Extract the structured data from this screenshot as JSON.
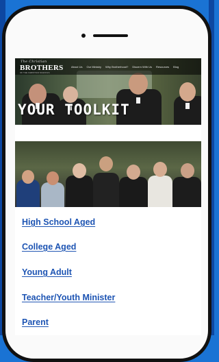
{
  "site": {
    "logo_script": "The Christian",
    "logo_main": "BROTHERS",
    "logo_sub": "OF THE CHRISTIAN SCHOOLS"
  },
  "nav": {
    "items": [
      "About Us",
      "Our Ministry",
      "Why Brotherhood?",
      "Discern With Us",
      "Resources",
      "Blog"
    ]
  },
  "hero": {
    "title": "YOUR TOOLKIT"
  },
  "links": [
    {
      "label": "High School Aged"
    },
    {
      "label": "College Aged"
    },
    {
      "label": "Young Adult"
    },
    {
      "label": "Teacher/Youth Minister"
    },
    {
      "label": "Parent"
    }
  ],
  "colors": {
    "background": "#1a73d4",
    "link": "#1d54b3",
    "phone_frame": "#111111"
  }
}
